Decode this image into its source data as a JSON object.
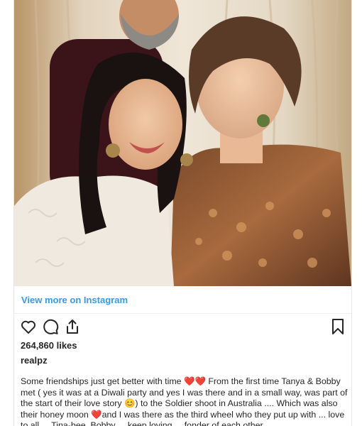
{
  "post": {
    "image_alt": "",
    "view_more_label": "View more on Instagram",
    "likes_text": "264,860 likes",
    "username": "realpz",
    "caption": "Some friendships just get better with time ❤️❤️ From the first time Tanya & Bobby met ( yes it was at a Diwali party and yes I was there and in a small way, was part of the start of their love story 😊) to the Soldier shoot in Australia .... Which was also their honey moon ❤️and I was there as the third wheel who they put up with ... love to all ... Tina-bee, Bobby ... keep loving ... fonder of each other ..."
  },
  "icons": {
    "like": "heart-icon",
    "comment": "comment-icon",
    "share": "share-icon",
    "save": "bookmark-icon"
  },
  "colors": {
    "link": "#3897f0",
    "text": "#262626"
  }
}
